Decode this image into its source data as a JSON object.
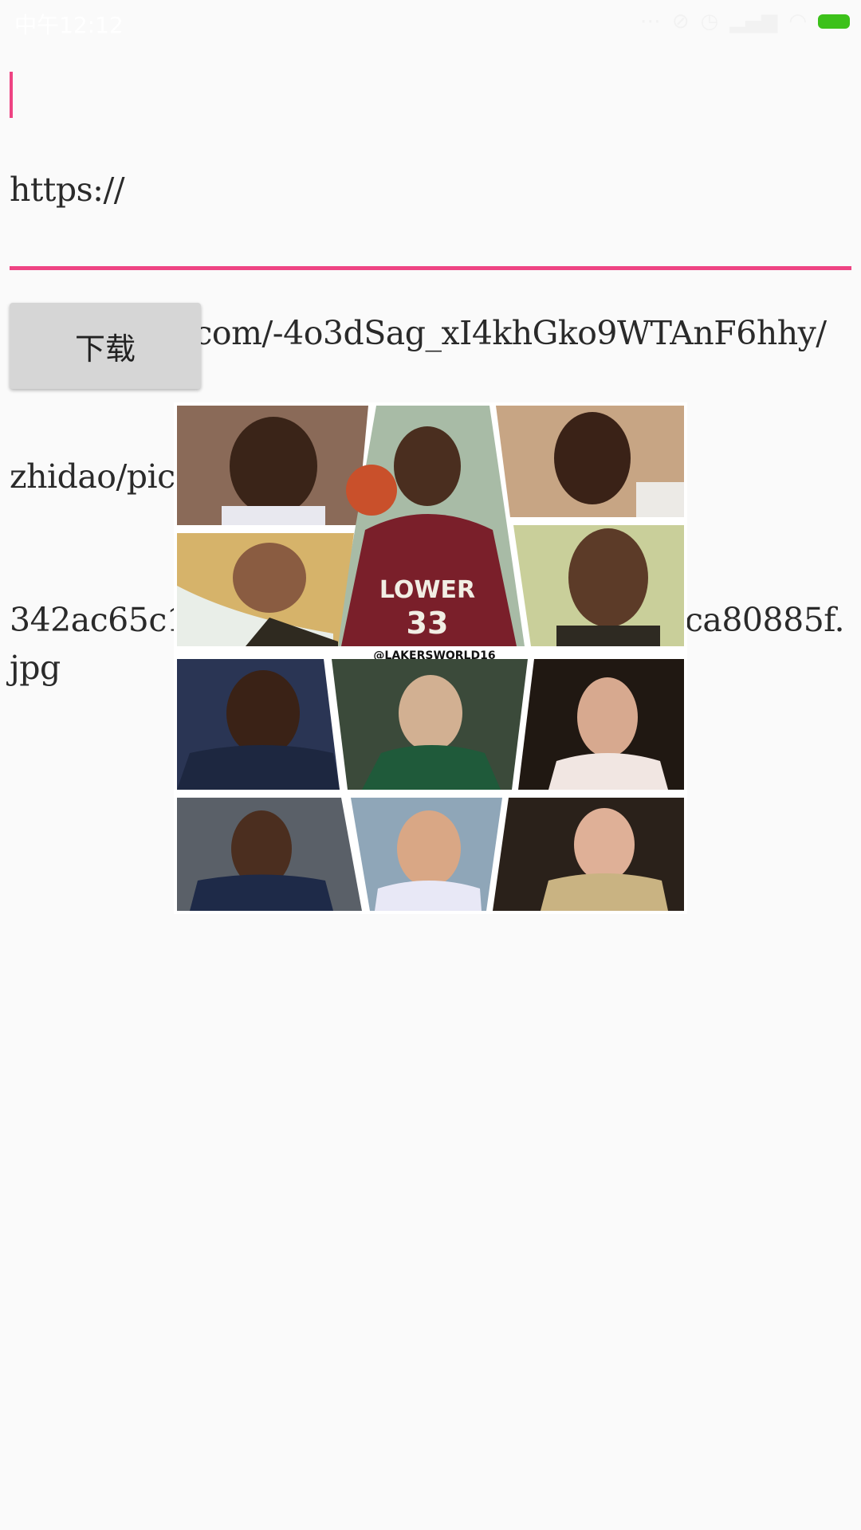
{
  "status_bar": {
    "time": "中午12:12",
    "icons": [
      "more-icon",
      "alarm-off-icon",
      "clock-icon",
      "signal-icon",
      "wifi-icon",
      "battery-icon"
    ]
  },
  "url_input": {
    "value": "https://gss0.baidu.com/-4o3dSag_xI4khGko9WTAnF6hhy/zhidao/pic/item/342ac65c10385343d779810190 13b07eca80885f.jpg",
    "lines": [
      "https://",
      "gss0.baidu.com/-4o3dSag_xI4khGko9WTAnF6hhy/",
      "zhidao/pic/item/",
      "342ac65c10385343d7798 10 190 13b07eca80885f.jpg"
    ],
    "accent_color": "#ee4483"
  },
  "download_button": {
    "label": "下载"
  },
  "image": {
    "watermark": "@LAKERSWORLD16",
    "jersey_text": "LOWER",
    "jersey_number": "33"
  }
}
